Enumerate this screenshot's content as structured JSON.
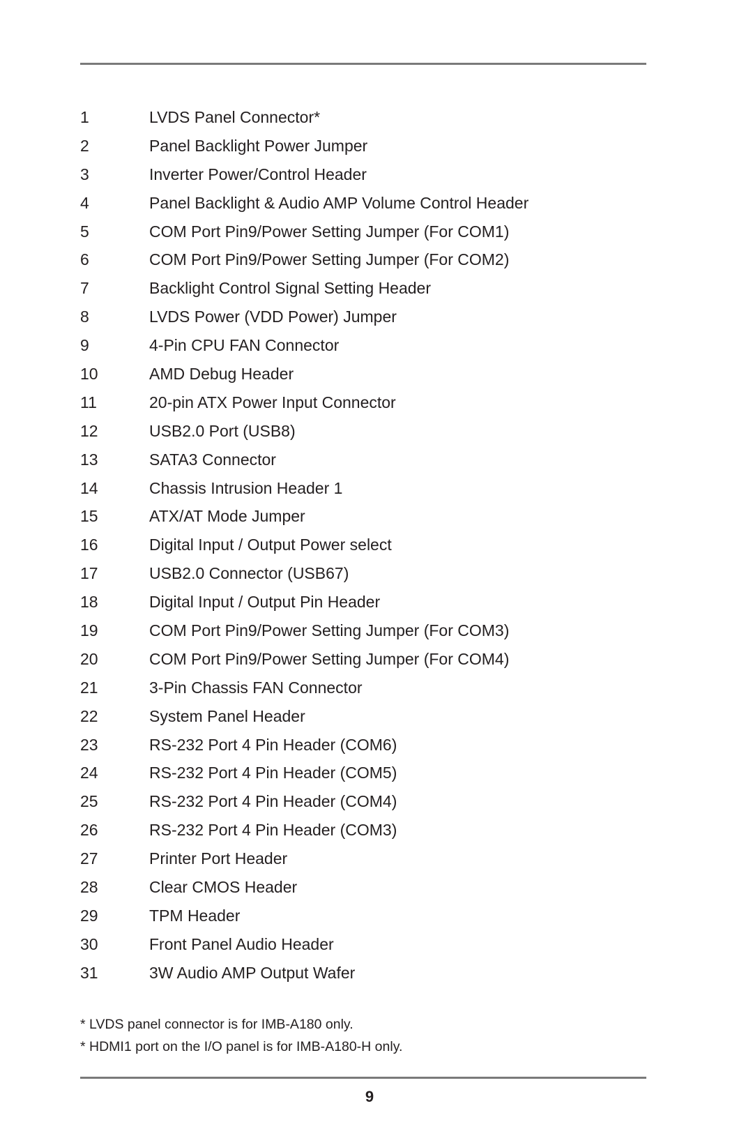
{
  "items": [
    {
      "num": "1",
      "label": "LVDS Panel Connector*"
    },
    {
      "num": "2",
      "label": "Panel Backlight Power Jumper"
    },
    {
      "num": "3",
      "label": "Inverter Power/Control Header"
    },
    {
      "num": "4",
      "label": "Panel Backlight & Audio AMP Volume Control Header"
    },
    {
      "num": "5",
      "label": "COM Port Pin9/Power Setting Jumper (For COM1)"
    },
    {
      "num": "6",
      "label": "COM Port Pin9/Power Setting Jumper (For COM2)"
    },
    {
      "num": "7",
      "label": "Backlight Control Signal Setting Header"
    },
    {
      "num": "8",
      "label": "LVDS Power (VDD Power) Jumper"
    },
    {
      "num": "9",
      "label": "4-Pin CPU FAN Connector"
    },
    {
      "num": "10",
      "label": "AMD Debug Header"
    },
    {
      "num": "11",
      "label": "20-pin ATX Power Input Connector"
    },
    {
      "num": "12",
      "label": "USB2.0 Port (USB8)"
    },
    {
      "num": "13",
      "label": "SATA3 Connector"
    },
    {
      "num": "14",
      "label": "Chassis Intrusion Header 1"
    },
    {
      "num": "15",
      "label": "ATX/AT Mode Jumper"
    },
    {
      "num": "16",
      "label": "Digital Input / Output Power select"
    },
    {
      "num": "17",
      "label": "USB2.0 Connector (USB67)"
    },
    {
      "num": "18",
      "label": "Digital Input / Output Pin Header"
    },
    {
      "num": "19",
      "label": "COM Port Pin9/Power Setting Jumper (For COM3)"
    },
    {
      "num": "20",
      "label": "COM Port Pin9/Power Setting Jumper (For COM4)"
    },
    {
      "num": "21",
      "label": "3-Pin Chassis FAN Connector"
    },
    {
      "num": "22",
      "label": "System Panel Header"
    },
    {
      "num": "23",
      "label": "RS-232 Port 4 Pin Header (COM6)"
    },
    {
      "num": "24",
      "label": "RS-232 Port 4 Pin Header (COM5)"
    },
    {
      "num": "25",
      "label": "RS-232 Port 4 Pin Header (COM4)"
    },
    {
      "num": "26",
      "label": "RS-232 Port 4 Pin Header (COM3)"
    },
    {
      "num": "27",
      "label": "Printer Port Header"
    },
    {
      "num": "28",
      "label": "Clear CMOS Header"
    },
    {
      "num": "29",
      "label": "TPM Header"
    },
    {
      "num": "30",
      "label": "Front Panel Audio Header"
    },
    {
      "num": "31",
      "label": "3W Audio AMP Output Wafer"
    }
  ],
  "notes": [
    "* LVDS panel connector is for IMB-A180 only.",
    "* HDMI1 port on the I/O panel is for IMB-A180-H only."
  ],
  "page_number": "9"
}
